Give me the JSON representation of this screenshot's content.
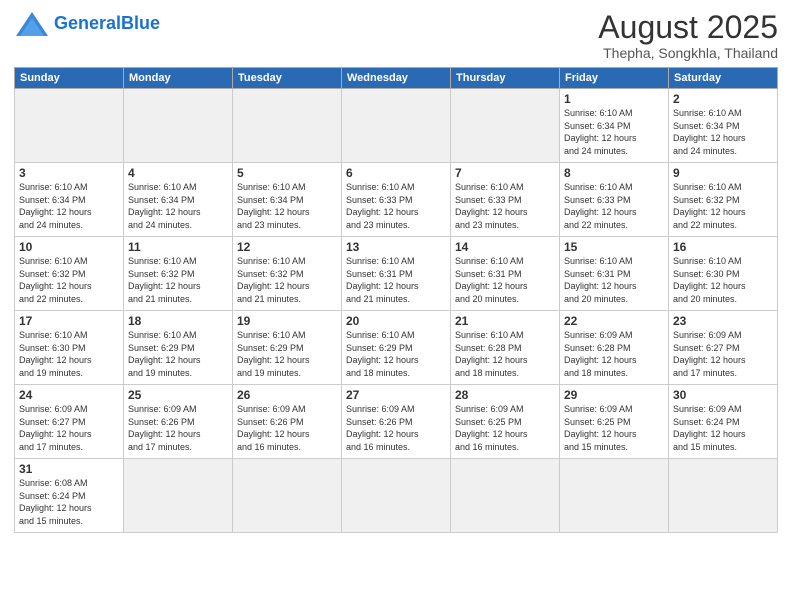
{
  "logo": {
    "general": "General",
    "blue": "Blue"
  },
  "header": {
    "title": "August 2025",
    "subtitle": "Thepha, Songkhla, Thailand"
  },
  "days_of_week": [
    "Sunday",
    "Monday",
    "Tuesday",
    "Wednesday",
    "Thursday",
    "Friday",
    "Saturday"
  ],
  "weeks": [
    [
      {
        "day": "",
        "info": ""
      },
      {
        "day": "",
        "info": ""
      },
      {
        "day": "",
        "info": ""
      },
      {
        "day": "",
        "info": ""
      },
      {
        "day": "",
        "info": ""
      },
      {
        "day": "1",
        "info": "Sunrise: 6:10 AM\nSunset: 6:34 PM\nDaylight: 12 hours\nand 24 minutes."
      },
      {
        "day": "2",
        "info": "Sunrise: 6:10 AM\nSunset: 6:34 PM\nDaylight: 12 hours\nand 24 minutes."
      }
    ],
    [
      {
        "day": "3",
        "info": "Sunrise: 6:10 AM\nSunset: 6:34 PM\nDaylight: 12 hours\nand 24 minutes."
      },
      {
        "day": "4",
        "info": "Sunrise: 6:10 AM\nSunset: 6:34 PM\nDaylight: 12 hours\nand 24 minutes."
      },
      {
        "day": "5",
        "info": "Sunrise: 6:10 AM\nSunset: 6:34 PM\nDaylight: 12 hours\nand 23 minutes."
      },
      {
        "day": "6",
        "info": "Sunrise: 6:10 AM\nSunset: 6:33 PM\nDaylight: 12 hours\nand 23 minutes."
      },
      {
        "day": "7",
        "info": "Sunrise: 6:10 AM\nSunset: 6:33 PM\nDaylight: 12 hours\nand 23 minutes."
      },
      {
        "day": "8",
        "info": "Sunrise: 6:10 AM\nSunset: 6:33 PM\nDaylight: 12 hours\nand 22 minutes."
      },
      {
        "day": "9",
        "info": "Sunrise: 6:10 AM\nSunset: 6:32 PM\nDaylight: 12 hours\nand 22 minutes."
      }
    ],
    [
      {
        "day": "10",
        "info": "Sunrise: 6:10 AM\nSunset: 6:32 PM\nDaylight: 12 hours\nand 22 minutes."
      },
      {
        "day": "11",
        "info": "Sunrise: 6:10 AM\nSunset: 6:32 PM\nDaylight: 12 hours\nand 21 minutes."
      },
      {
        "day": "12",
        "info": "Sunrise: 6:10 AM\nSunset: 6:32 PM\nDaylight: 12 hours\nand 21 minutes."
      },
      {
        "day": "13",
        "info": "Sunrise: 6:10 AM\nSunset: 6:31 PM\nDaylight: 12 hours\nand 21 minutes."
      },
      {
        "day": "14",
        "info": "Sunrise: 6:10 AM\nSunset: 6:31 PM\nDaylight: 12 hours\nand 20 minutes."
      },
      {
        "day": "15",
        "info": "Sunrise: 6:10 AM\nSunset: 6:31 PM\nDaylight: 12 hours\nand 20 minutes."
      },
      {
        "day": "16",
        "info": "Sunrise: 6:10 AM\nSunset: 6:30 PM\nDaylight: 12 hours\nand 20 minutes."
      }
    ],
    [
      {
        "day": "17",
        "info": "Sunrise: 6:10 AM\nSunset: 6:30 PM\nDaylight: 12 hours\nand 19 minutes."
      },
      {
        "day": "18",
        "info": "Sunrise: 6:10 AM\nSunset: 6:29 PM\nDaylight: 12 hours\nand 19 minutes."
      },
      {
        "day": "19",
        "info": "Sunrise: 6:10 AM\nSunset: 6:29 PM\nDaylight: 12 hours\nand 19 minutes."
      },
      {
        "day": "20",
        "info": "Sunrise: 6:10 AM\nSunset: 6:29 PM\nDaylight: 12 hours\nand 18 minutes."
      },
      {
        "day": "21",
        "info": "Sunrise: 6:10 AM\nSunset: 6:28 PM\nDaylight: 12 hours\nand 18 minutes."
      },
      {
        "day": "22",
        "info": "Sunrise: 6:09 AM\nSunset: 6:28 PM\nDaylight: 12 hours\nand 18 minutes."
      },
      {
        "day": "23",
        "info": "Sunrise: 6:09 AM\nSunset: 6:27 PM\nDaylight: 12 hours\nand 17 minutes."
      }
    ],
    [
      {
        "day": "24",
        "info": "Sunrise: 6:09 AM\nSunset: 6:27 PM\nDaylight: 12 hours\nand 17 minutes."
      },
      {
        "day": "25",
        "info": "Sunrise: 6:09 AM\nSunset: 6:26 PM\nDaylight: 12 hours\nand 17 minutes."
      },
      {
        "day": "26",
        "info": "Sunrise: 6:09 AM\nSunset: 6:26 PM\nDaylight: 12 hours\nand 16 minutes."
      },
      {
        "day": "27",
        "info": "Sunrise: 6:09 AM\nSunset: 6:26 PM\nDaylight: 12 hours\nand 16 minutes."
      },
      {
        "day": "28",
        "info": "Sunrise: 6:09 AM\nSunset: 6:25 PM\nDaylight: 12 hours\nand 16 minutes."
      },
      {
        "day": "29",
        "info": "Sunrise: 6:09 AM\nSunset: 6:25 PM\nDaylight: 12 hours\nand 15 minutes."
      },
      {
        "day": "30",
        "info": "Sunrise: 6:09 AM\nSunset: 6:24 PM\nDaylight: 12 hours\nand 15 minutes."
      }
    ],
    [
      {
        "day": "31",
        "info": "Sunrise: 6:08 AM\nSunset: 6:24 PM\nDaylight: 12 hours\nand 15 minutes."
      },
      {
        "day": "",
        "info": ""
      },
      {
        "day": "",
        "info": ""
      },
      {
        "day": "",
        "info": ""
      },
      {
        "day": "",
        "info": ""
      },
      {
        "day": "",
        "info": ""
      },
      {
        "day": "",
        "info": ""
      }
    ]
  ]
}
